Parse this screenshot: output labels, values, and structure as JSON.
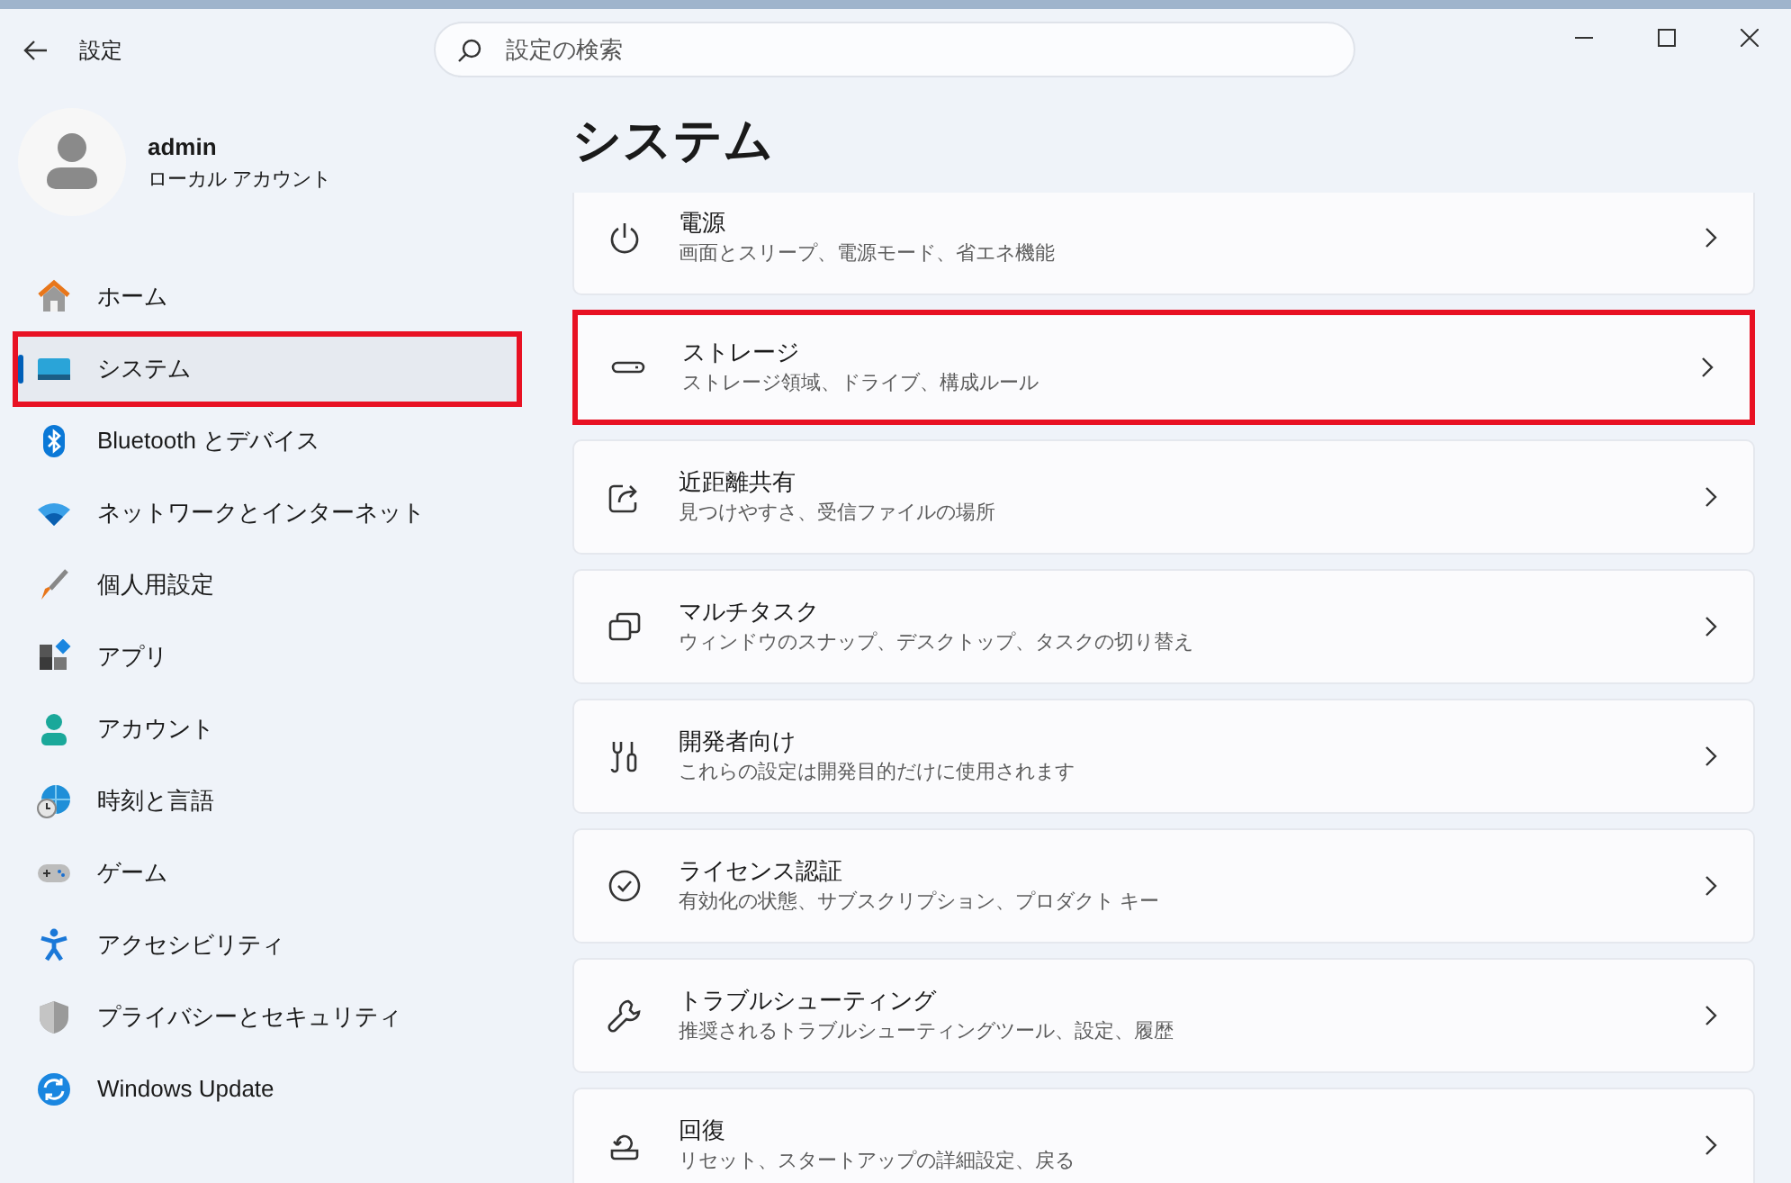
{
  "window": {
    "title": "設定"
  },
  "search": {
    "placeholder": "設定の検索"
  },
  "account": {
    "name": "admin",
    "type": "ローカル アカウント"
  },
  "sidebar": {
    "items": [
      {
        "label": "ホーム",
        "selected": false,
        "highlighted": false
      },
      {
        "label": "システム",
        "selected": true,
        "highlighted": true
      },
      {
        "label": "Bluetooth とデバイス",
        "selected": false,
        "highlighted": false
      },
      {
        "label": "ネットワークとインターネット",
        "selected": false,
        "highlighted": false
      },
      {
        "label": "個人用設定",
        "selected": false,
        "highlighted": false
      },
      {
        "label": "アプリ",
        "selected": false,
        "highlighted": false
      },
      {
        "label": "アカウント",
        "selected": false,
        "highlighted": false
      },
      {
        "label": "時刻と言語",
        "selected": false,
        "highlighted": false
      },
      {
        "label": "ゲーム",
        "selected": false,
        "highlighted": false
      },
      {
        "label": "アクセシビリティ",
        "selected": false,
        "highlighted": false
      },
      {
        "label": "プライバシーとセキュリティ",
        "selected": false,
        "highlighted": false
      },
      {
        "label": "Windows Update",
        "selected": false,
        "highlighted": false
      }
    ]
  },
  "page": {
    "title": "システム",
    "items": [
      {
        "title": "電源",
        "description": "画面とスリープ、電源モード、省エネ機能",
        "highlighted": false
      },
      {
        "title": "ストレージ",
        "description": "ストレージ領域、ドライブ、構成ルール",
        "highlighted": true
      },
      {
        "title": "近距離共有",
        "description": "見つけやすさ、受信ファイルの場所",
        "highlighted": false
      },
      {
        "title": "マルチタスク",
        "description": "ウィンドウのスナップ、デスクトップ、タスクの切り替え",
        "highlighted": false
      },
      {
        "title": "開発者向け",
        "description": "これらの設定は開発目的だけに使用されます",
        "highlighted": false
      },
      {
        "title": "ライセンス認証",
        "description": "有効化の状態、サブスクリプション、プロダクト キー",
        "highlighted": false
      },
      {
        "title": "トラブルシューティング",
        "description": "推奨されるトラブルシューティングツール、設定、履歴",
        "highlighted": false
      },
      {
        "title": "回復",
        "description": "リセット、スタートアップの詳細設定、戻る",
        "highlighted": false
      }
    ]
  }
}
